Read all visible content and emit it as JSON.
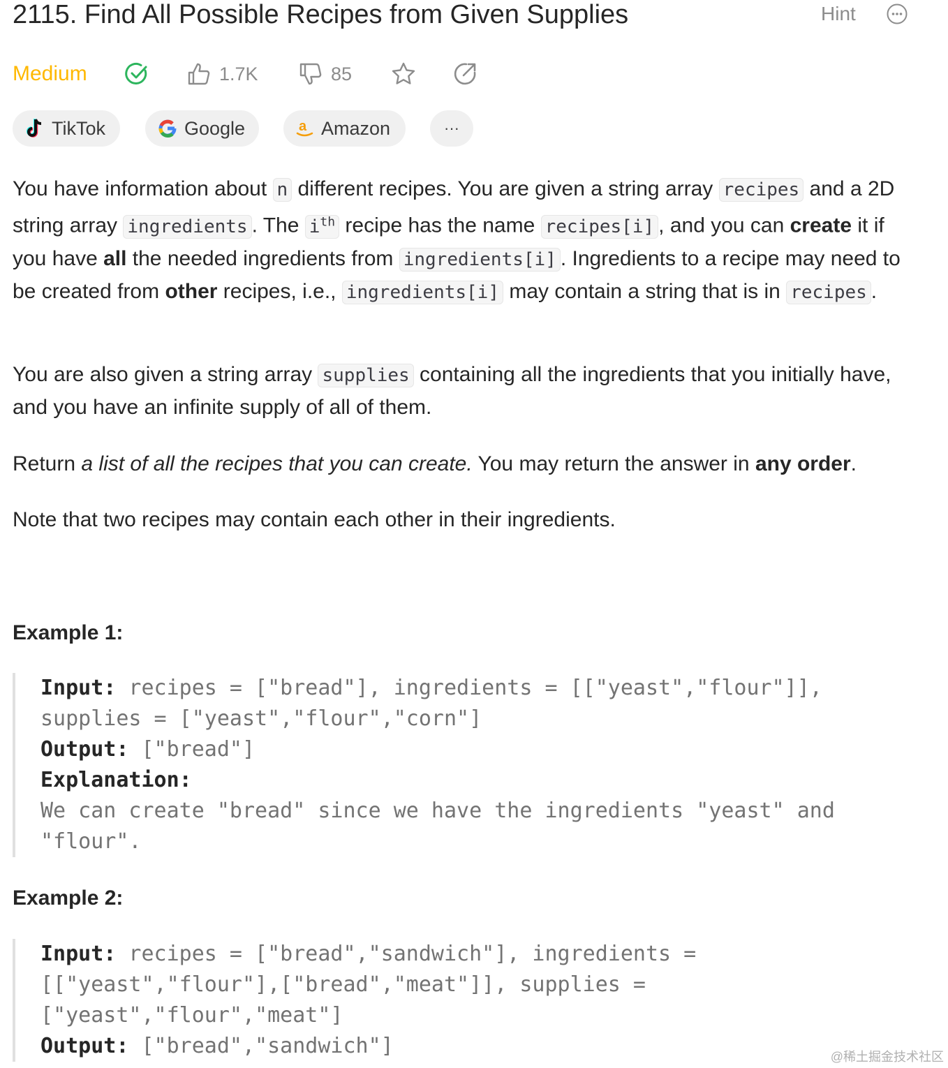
{
  "problem": {
    "title": "2115. Find All Possible Recipes from Given Supplies",
    "hint_label": "Hint",
    "difficulty": "Medium",
    "likes": "1.7K",
    "dislikes": "85"
  },
  "tags": [
    {
      "label": "TikTok",
      "icon": "tiktok-icon"
    },
    {
      "label": "Google",
      "icon": "google-icon"
    },
    {
      "label": "Amazon",
      "icon": "amazon-icon"
    },
    {
      "label": "···",
      "icon": "more-icon"
    }
  ],
  "description": {
    "p1": {
      "t1": "You have information about ",
      "c1": "n",
      "t2": " different recipes. You are given a string array ",
      "c2": "recipes",
      "t3": " and a 2D string array ",
      "c3": "ingredients",
      "t4": ". The ",
      "c4": "i",
      "sup": "th",
      "t5": " recipe has the name ",
      "c5": "recipes[i]",
      "t6": ", and you can ",
      "b1": "create",
      "t7": " it if you have ",
      "b2": "all",
      "t8": " the needed ingredients from ",
      "c6": "ingredients[i]",
      "t9": ". Ingredients to a recipe may need to be created from ",
      "b3": "other",
      "t10": " recipes, i.e., ",
      "c7": "ingredients[i]",
      "t11": " may contain a string that is in ",
      "c8": "recipes",
      "t12": "."
    },
    "p2": {
      "t1": "You are also given a string array ",
      "c1": "supplies",
      "t2": " containing all the ingredients that you initially have, and you have an infinite supply of all of them."
    },
    "p3": {
      "t1": "Return ",
      "i1": "a list of all the recipes that you can create.",
      "t2": " You may return the answer in ",
      "b1": "any order",
      "t3": "."
    },
    "p4": "Note that two recipes may contain each other in their ingredients."
  },
  "examples": [
    {
      "title": "Example 1:",
      "input_label": "Input:",
      "input": " recipes = [\"bread\"], ingredients = [[\"yeast\",\"flour\"]],\nsupplies = [\"yeast\",\"flour\",\"corn\"]",
      "output_label": "Output:",
      "output": " [\"bread\"]",
      "explanation_label": "Explanation:",
      "explanation": "We can create \"bread\" since we have the ingredients \"yeast\" and\n\"flour\"."
    },
    {
      "title": "Example 2:",
      "input_label": "Input:",
      "input": " recipes = [\"bread\",\"sandwich\"], ingredients =\n[[\"yeast\",\"flour\"],[\"bread\",\"meat\"]], supplies =\n[\"yeast\",\"flour\",\"meat\"]",
      "output_label": "Output:",
      "output": " [\"bread\",\"sandwich\"]"
    }
  ],
  "watermark": "@稀土掘金技术社区",
  "colors": {
    "difficulty": "#ffb800",
    "solved": "#2db55d"
  }
}
